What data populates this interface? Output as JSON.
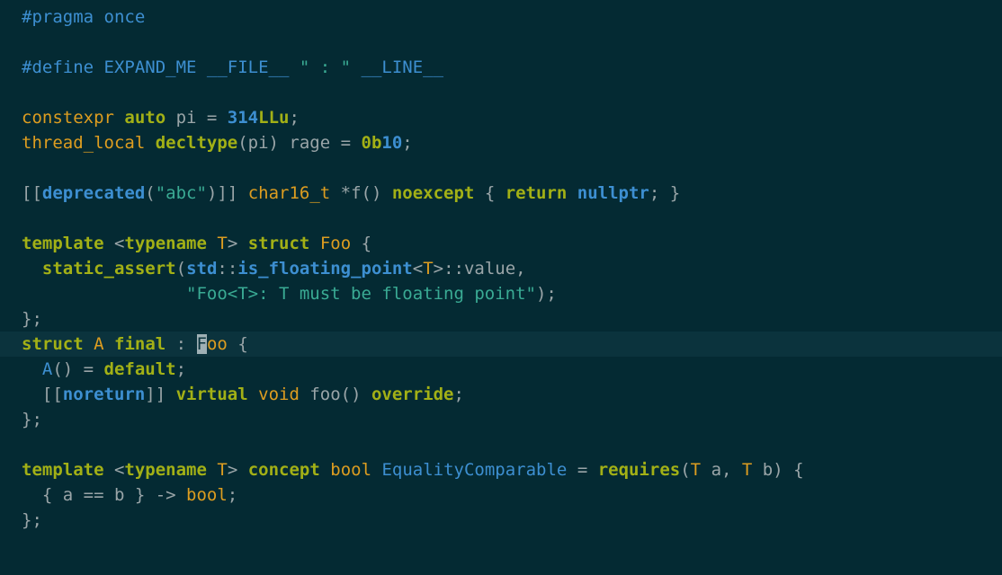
{
  "editor": {
    "language": "C++",
    "theme_name": "dark-teal",
    "background_color": "#042a33",
    "current_line_color": "#0b333d",
    "cursor_color": "#9fb0b5",
    "palette": {
      "plain": "#9aa5a8",
      "preprocessor": "#3d8fd1",
      "identifier": "#3d8fd1",
      "string": "#3aab94",
      "keyword": "#a2b016",
      "type": "#dd9d20",
      "number": "#3d8fd1",
      "number_suffix": "#a2b016"
    },
    "cursor": {
      "line_index": 13,
      "column_index": 19,
      "char": "F"
    },
    "lines": [
      {
        "index": 0,
        "current": false,
        "text": "#pragma once",
        "tokens": [
          {
            "cls": "t-pp",
            "text": "#pragma once"
          }
        ]
      },
      {
        "index": 1,
        "current": false,
        "text": "",
        "tokens": []
      },
      {
        "index": 2,
        "current": false,
        "text": "#define EXPAND_ME __FILE__ \" : \" __LINE__",
        "tokens": [
          {
            "cls": "t-pp",
            "text": "#define EXPAND_ME __FILE__ "
          },
          {
            "cls": "t-str",
            "text": "\" : \""
          },
          {
            "cls": "t-pp",
            "text": " __LINE__"
          }
        ]
      },
      {
        "index": 3,
        "current": false,
        "text": "",
        "tokens": []
      },
      {
        "index": 4,
        "current": false,
        "text": "constexpr auto pi = 314LLu;",
        "tokens": [
          {
            "cls": "t-type",
            "text": "constexpr "
          },
          {
            "cls": "t-kw",
            "text": "auto"
          },
          {
            "cls": "t-plain",
            "text": " pi = "
          },
          {
            "cls": "t-num",
            "text": "314"
          },
          {
            "cls": "t-numsuf",
            "text": "LLu"
          },
          {
            "cls": "t-plain",
            "text": ";"
          }
        ]
      },
      {
        "index": 5,
        "current": false,
        "text": "thread_local decltype(pi) rage = 0b10;",
        "tokens": [
          {
            "cls": "t-type",
            "text": "thread_local "
          },
          {
            "cls": "t-kw",
            "text": "decltype"
          },
          {
            "cls": "t-plain",
            "text": "(pi) rage = "
          },
          {
            "cls": "t-numsuf",
            "text": "0b"
          },
          {
            "cls": "t-num",
            "text": "10"
          },
          {
            "cls": "t-plain",
            "text": ";"
          }
        ]
      },
      {
        "index": 6,
        "current": false,
        "text": "",
        "tokens": []
      },
      {
        "index": 7,
        "current": false,
        "text": "[[deprecated(\"abc\")]] char16_t *f() noexcept { return nullptr; }",
        "tokens": [
          {
            "cls": "t-plain",
            "text": "[["
          },
          {
            "cls": "t-identb",
            "text": "deprecated"
          },
          {
            "cls": "t-plain",
            "text": "("
          },
          {
            "cls": "t-str",
            "text": "\"abc\""
          },
          {
            "cls": "t-plain",
            "text": ")]] "
          },
          {
            "cls": "t-type",
            "text": "char16_t"
          },
          {
            "cls": "t-plain",
            "text": " *f() "
          },
          {
            "cls": "t-kw",
            "text": "noexcept"
          },
          {
            "cls": "t-plain",
            "text": " { "
          },
          {
            "cls": "t-kw",
            "text": "return"
          },
          {
            "cls": "t-plain",
            "text": " "
          },
          {
            "cls": "t-identb",
            "text": "nullptr"
          },
          {
            "cls": "t-plain",
            "text": "; }"
          }
        ]
      },
      {
        "index": 8,
        "current": false,
        "text": "",
        "tokens": []
      },
      {
        "index": 9,
        "current": false,
        "text": "template <typename T> struct Foo {",
        "tokens": [
          {
            "cls": "t-kw",
            "text": "template"
          },
          {
            "cls": "t-plain",
            "text": " <"
          },
          {
            "cls": "t-kw",
            "text": "typename"
          },
          {
            "cls": "t-plain",
            "text": " "
          },
          {
            "cls": "t-type",
            "text": "T"
          },
          {
            "cls": "t-plain",
            "text": "> "
          },
          {
            "cls": "t-kw",
            "text": "struct"
          },
          {
            "cls": "t-plain",
            "text": " "
          },
          {
            "cls": "t-type",
            "text": "Foo"
          },
          {
            "cls": "t-plain",
            "text": " {"
          }
        ]
      },
      {
        "index": 10,
        "current": false,
        "text": "  static_assert(std::is_floating_point<T>::value,",
        "tokens": [
          {
            "cls": "t-plain",
            "text": "  "
          },
          {
            "cls": "t-kw",
            "text": "static_assert"
          },
          {
            "cls": "t-plain",
            "text": "("
          },
          {
            "cls": "t-identb",
            "text": "std"
          },
          {
            "cls": "t-plain",
            "text": "::"
          },
          {
            "cls": "t-identb",
            "text": "is_floating_point"
          },
          {
            "cls": "t-plain",
            "text": "<"
          },
          {
            "cls": "t-type",
            "text": "T"
          },
          {
            "cls": "t-plain",
            "text": ">::value,"
          }
        ]
      },
      {
        "index": 11,
        "current": false,
        "text": "                \"Foo<T>: T must be floating point\");",
        "tokens": [
          {
            "cls": "t-plain",
            "text": "                "
          },
          {
            "cls": "t-str",
            "text": "\"Foo<T>: T must be floating point\""
          },
          {
            "cls": "t-plain",
            "text": ");"
          }
        ]
      },
      {
        "index": 12,
        "current": false,
        "text": "};",
        "tokens": [
          {
            "cls": "t-plain",
            "text": "};"
          }
        ]
      },
      {
        "index": 13,
        "current": true,
        "text": "struct A final : Foo {",
        "tokens": [
          {
            "cls": "t-kw",
            "text": "struct"
          },
          {
            "cls": "t-plain",
            "text": " "
          },
          {
            "cls": "t-type",
            "text": "A"
          },
          {
            "cls": "t-plain",
            "text": " "
          },
          {
            "cls": "t-kw",
            "text": "final"
          },
          {
            "cls": "t-plain",
            "text": " : "
          },
          {
            "cls": "t-cursor",
            "text": "F"
          },
          {
            "cls": "t-type",
            "text": "oo"
          },
          {
            "cls": "t-plain",
            "text": " {"
          }
        ]
      },
      {
        "index": 14,
        "current": false,
        "text": "  A() = default;",
        "tokens": [
          {
            "cls": "t-plain",
            "text": "  "
          },
          {
            "cls": "t-ident",
            "text": "A"
          },
          {
            "cls": "t-plain",
            "text": "() = "
          },
          {
            "cls": "t-kw",
            "text": "default"
          },
          {
            "cls": "t-plain",
            "text": ";"
          }
        ]
      },
      {
        "index": 15,
        "current": false,
        "text": "  [[noreturn]] virtual void foo() override;",
        "tokens": [
          {
            "cls": "t-plain",
            "text": "  [["
          },
          {
            "cls": "t-identb",
            "text": "noreturn"
          },
          {
            "cls": "t-plain",
            "text": "]] "
          },
          {
            "cls": "t-kw",
            "text": "virtual"
          },
          {
            "cls": "t-plain",
            "text": " "
          },
          {
            "cls": "t-type",
            "text": "void"
          },
          {
            "cls": "t-plain",
            "text": " foo() "
          },
          {
            "cls": "t-kw",
            "text": "override"
          },
          {
            "cls": "t-plain",
            "text": ";"
          }
        ]
      },
      {
        "index": 16,
        "current": false,
        "text": "};",
        "tokens": [
          {
            "cls": "t-plain",
            "text": "};"
          }
        ]
      },
      {
        "index": 17,
        "current": false,
        "text": "",
        "tokens": []
      },
      {
        "index": 18,
        "current": false,
        "text": "template <typename T> concept bool EqualityComparable = requires(T a, T b) {",
        "tokens": [
          {
            "cls": "t-kw",
            "text": "template"
          },
          {
            "cls": "t-plain",
            "text": " <"
          },
          {
            "cls": "t-kw",
            "text": "typename"
          },
          {
            "cls": "t-plain",
            "text": " "
          },
          {
            "cls": "t-type",
            "text": "T"
          },
          {
            "cls": "t-plain",
            "text": "> "
          },
          {
            "cls": "t-kw",
            "text": "concept"
          },
          {
            "cls": "t-plain",
            "text": " "
          },
          {
            "cls": "t-type",
            "text": "bool"
          },
          {
            "cls": "t-plain",
            "text": " "
          },
          {
            "cls": "t-ident",
            "text": "EqualityComparable"
          },
          {
            "cls": "t-plain",
            "text": " = "
          },
          {
            "cls": "t-kw",
            "text": "requires"
          },
          {
            "cls": "t-plain",
            "text": "("
          },
          {
            "cls": "t-type",
            "text": "T"
          },
          {
            "cls": "t-plain",
            "text": " a, "
          },
          {
            "cls": "t-type",
            "text": "T"
          },
          {
            "cls": "t-plain",
            "text": " b) {"
          }
        ]
      },
      {
        "index": 19,
        "current": false,
        "text": "  { a == b } -> bool;",
        "tokens": [
          {
            "cls": "t-plain",
            "text": "  { a == b } -> "
          },
          {
            "cls": "t-type",
            "text": "bool"
          },
          {
            "cls": "t-plain",
            "text": ";"
          }
        ]
      },
      {
        "index": 20,
        "current": false,
        "text": "};",
        "tokens": [
          {
            "cls": "t-plain",
            "text": "};"
          }
        ]
      }
    ]
  }
}
